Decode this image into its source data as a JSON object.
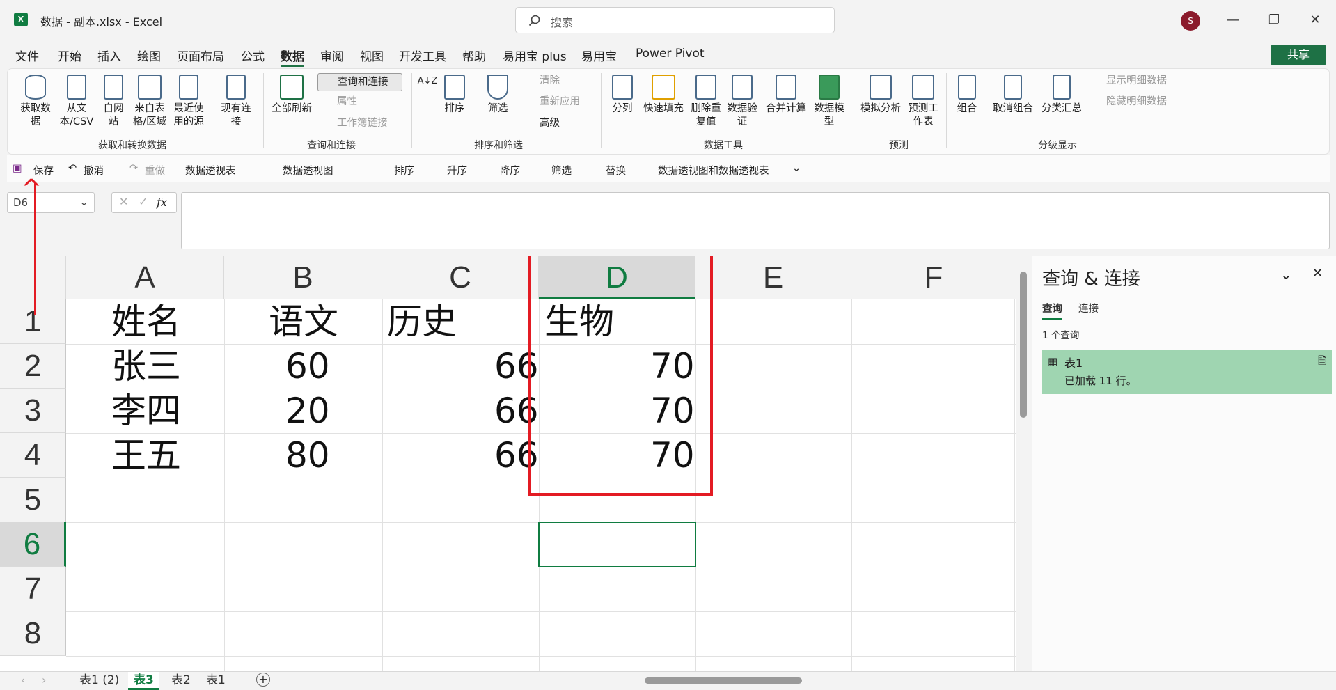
{
  "window": {
    "title": "数据 - 副本.xlsx  -  Excel",
    "search_placeholder": "搜索",
    "avatar": "S",
    "minimize": "—",
    "restore": "❐",
    "close": "✕"
  },
  "menu": {
    "items": [
      "文件",
      "开始",
      "插入",
      "绘图",
      "页面布局",
      "公式",
      "数据",
      "审阅",
      "视图",
      "开发工具",
      "帮助",
      "易用宝 plus",
      "易用宝",
      "Power Pivot"
    ],
    "active": "数据",
    "share": "共享"
  },
  "ribbon": {
    "get_data": "获取数据",
    "from_text": "从文本/CSV",
    "from_web": "自网站",
    "from_table": "来自表格/区域",
    "recent_sources": "最近使用的源",
    "existing_conn": "现有连接",
    "group1": "获取和转换数据",
    "refresh_all": "全部刷新",
    "queries_conn": "查询和连接",
    "properties": "属性",
    "edit_links": "工作簿链接",
    "group2": "查询和连接",
    "sort": "排序",
    "filter": "筛选",
    "clear": "清除",
    "reapply": "重新应用",
    "advanced": "高级",
    "group3": "排序和筛选",
    "text_to_col": "分列",
    "flash_fill": "快速填充",
    "remove_dup": "删除重复值",
    "data_valid": "数据验证",
    "consolidate": "合并计算",
    "data_model": "数据模型",
    "group4": "数据工具",
    "whatif": "模拟分析",
    "forecast": "预测工作表",
    "group5": "预测",
    "group_btn": "组合",
    "ungroup": "取消组合",
    "subtotal": "分类汇总",
    "show_detail": "显示明细数据",
    "hide_detail": "隐藏明细数据",
    "group6": "分级显示"
  },
  "qat": {
    "save": "保存",
    "undo": "撤消",
    "redo": "重做",
    "pivot_table": "数据透视表",
    "pivot_chart": "数据透视图",
    "sort": "排序",
    "asc": "升序",
    "desc": "降序",
    "filter": "筛选",
    "replace": "替换",
    "pivot_both": "数据透视图和数据透视表"
  },
  "formula": {
    "namebox": "D6",
    "fx": "fx"
  },
  "sheet": {
    "columns": [
      "A",
      "B",
      "C",
      "D",
      "E",
      "F"
    ],
    "rows": [
      "1",
      "2",
      "3",
      "4",
      "5",
      "6",
      "7",
      "8"
    ],
    "cells": {
      "A1": "姓名",
      "B1": "语文",
      "C1": "历史",
      "D1": "生物",
      "A2": "张三",
      "B2": "60",
      "C2": "66",
      "D2": "70",
      "A3": "李四",
      "B3": "20",
      "C3": "66",
      "D3": "70",
      "A4": "王五",
      "B4": "80",
      "C4": "66",
      "D4": "70"
    },
    "selected_cell": "D6"
  },
  "pane": {
    "title": "查询 & 连接",
    "tab_query": "查询",
    "tab_conn": "连接",
    "count": "1 个查询",
    "query_name": "表1",
    "query_status": "已加载 11 行。"
  },
  "sheet_tabs": {
    "tabs": [
      "表1 (2)",
      "表3",
      "表2",
      "表1"
    ],
    "active": "表3"
  },
  "colors": {
    "accent": "#107c41",
    "annotation": "#e31b23",
    "query_bg": "#9fd5b1"
  }
}
